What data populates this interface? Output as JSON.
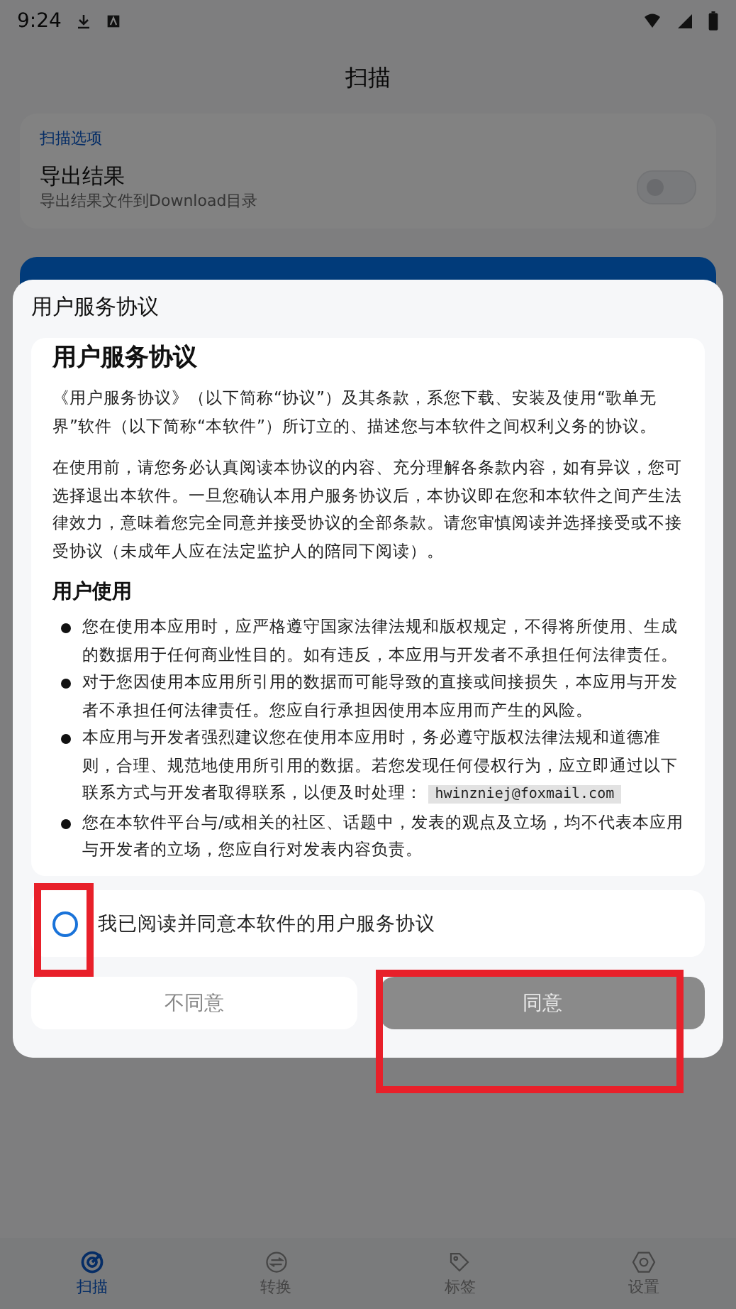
{
  "status_bar": {
    "time": "9:24"
  },
  "header": {
    "title": "扫描"
  },
  "options_card": {
    "section_label": "扫描选项",
    "setting": {
      "title": "导出结果",
      "subtitle": "导出结果文件到Download目录",
      "on": false
    }
  },
  "dialog": {
    "title": "用户服务协议",
    "document": {
      "heading": "用户服务协议",
      "paragraphs": [
        "《用户服务协议》（以下简称“协议”）及其条款，系您下载、安装及使用“歌单无界”软件（以下简称“本软件”）所订立的、描述您与本软件之间权利义务的协议。",
        "在使用前，请您务必认真阅读本协议的内容、充分理解各条款内容，如有异议，您可选择退出本软件。一旦您确认本用户服务协议后，本协议即在您和本软件之间产生法律效力，意味着您完全同意并接受协议的全部条款。请您审慎阅读并选择接受或不接受协议（未成年人应在法定监护人的陪同下阅读）。"
      ],
      "section_heading": "用户使用",
      "bullets": [
        {
          "text": "您在使用本应用时，应严格遵守国家法律法规和版权规定，不得将所使用、生成的数据用于任何商业性目的。如有违反，本应用与开发者不承担任何法律责任。"
        },
        {
          "text": "对于您因使用本应用所引用的数据而可能导致的直接或间接损失，本应用与开发者不承担任何法律责任。您应自行承担因使用本应用而产生的风险。"
        },
        {
          "text": "本应用与开发者强烈建议您在使用本应用时，务必遵守版权法律法规和道德准则，合理、规范地使用所引用的数据。若您发现任何侵权行为，应立即通过以下联系方式与开发者取得联系，以便及时处理：",
          "email": "hwinzniej@foxmail.com"
        },
        {
          "text": "您在本软件平台与/或相关的社区、话题中，发表的观点及立场，均不代表本应用与开发者的立场，您应自行对发表内容负责。"
        }
      ]
    },
    "consent": {
      "label": "我已阅读并同意本软件的用户服务协议",
      "checked": false,
      "highlighted": true
    },
    "buttons": [
      {
        "label": "不同意",
        "kind": "secondary",
        "disabled": false,
        "highlighted": false
      },
      {
        "label": "同意",
        "kind": "primary",
        "disabled": true,
        "highlighted": true
      }
    ]
  },
  "bottom_nav": [
    {
      "label": "扫描",
      "selected": true
    },
    {
      "label": "转换",
      "selected": false
    },
    {
      "label": "标签",
      "selected": false
    },
    {
      "label": "设置",
      "selected": false
    }
  ]
}
